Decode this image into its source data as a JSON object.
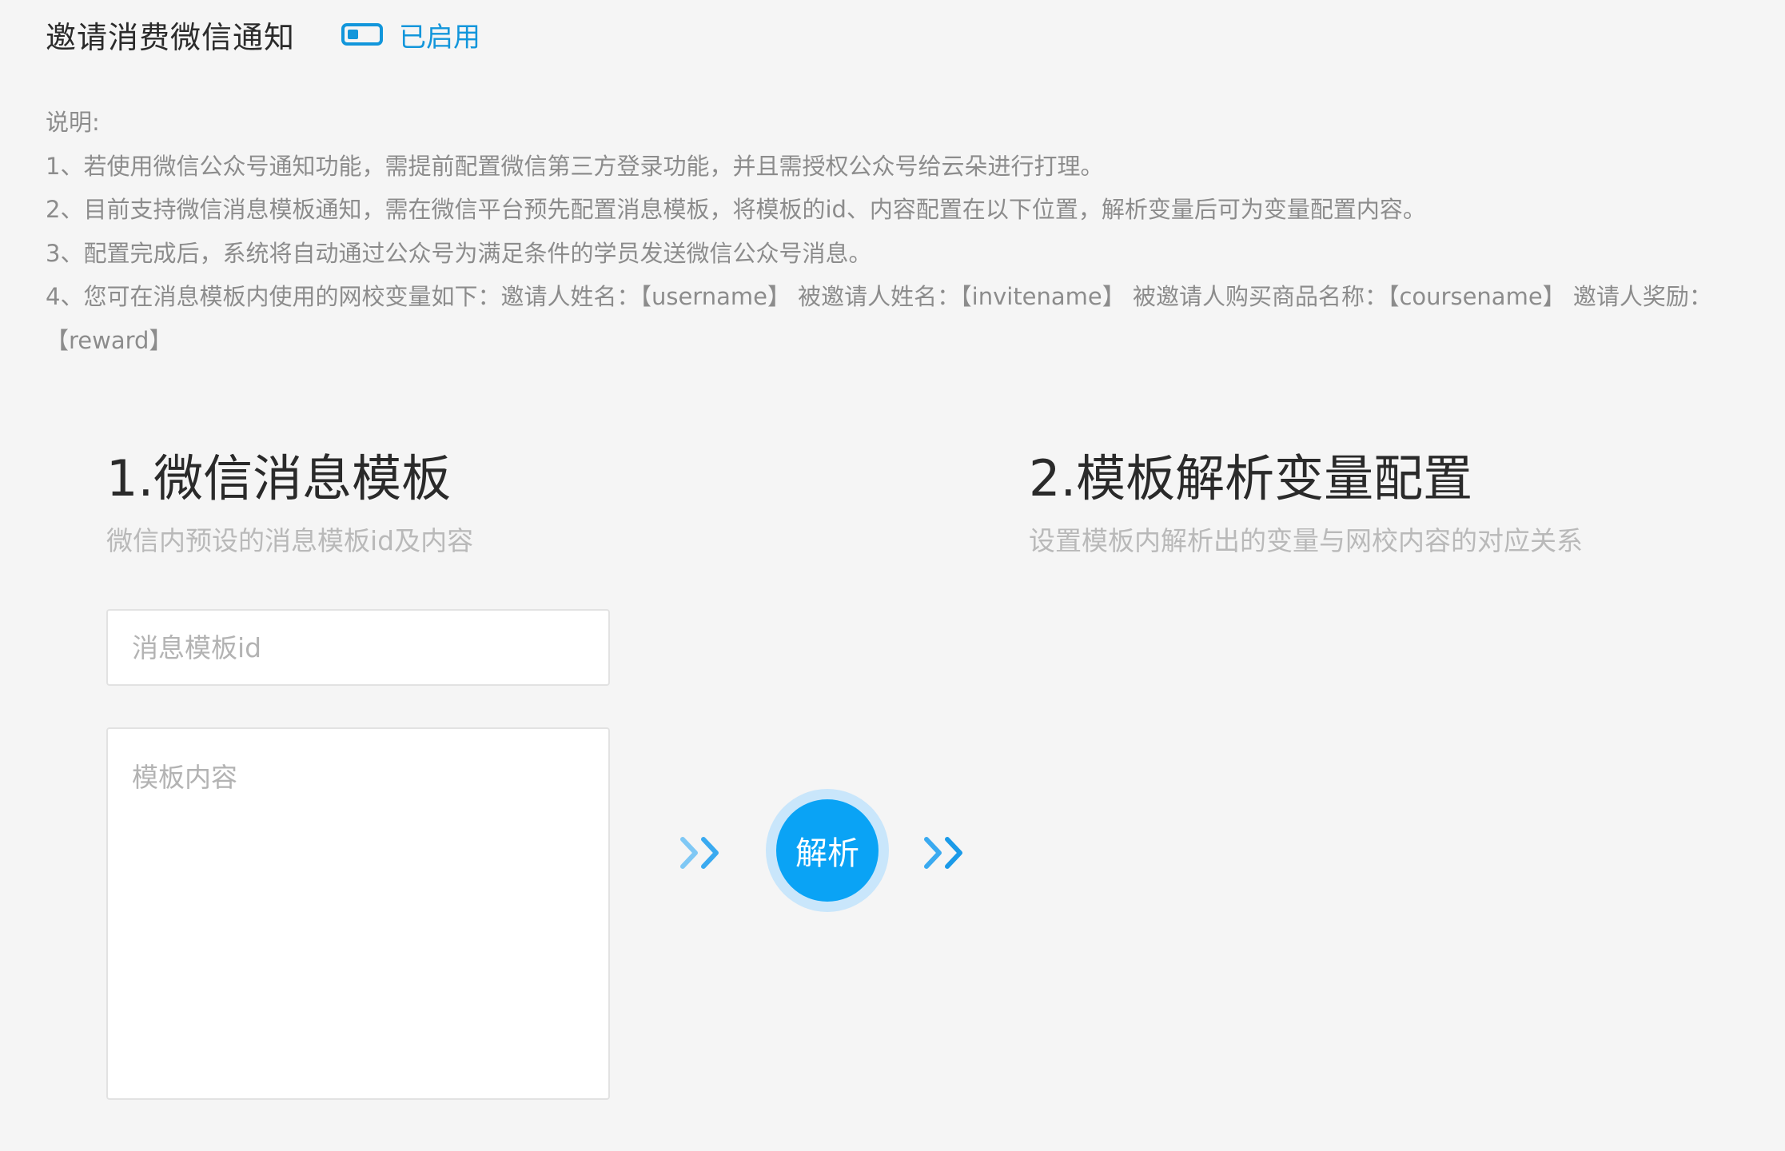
{
  "header": {
    "title": "邀请消费微信通知",
    "toggle_label": "已启用",
    "toggle_on": true,
    "accent_color": "#1296db"
  },
  "notes": {
    "heading": "说明:",
    "items": [
      "1、若使用微信公众号通知功能，需提前配置微信第三方登录功能，并且需授权公众号给云朵进行打理。",
      "2、目前支持微信消息模板通知，需在微信平台预先配置消息模板，将模板的id、内容配置在以下位置，解析变量后可为变量配置内容。",
      "3、配置完成后，系统将自动通过公众号为满足条件的学员发送微信公众号消息。",
      "4、您可在消息模板内使用的网校变量如下：邀请人姓名：【username】 被邀请人姓名：【invitename】 被邀请人购买商品名称：【coursename】 邀请人奖励：【reward】"
    ]
  },
  "section1": {
    "title": "1.微信消息模板",
    "subtitle": "微信内预设的消息模板id及内容",
    "template_id_placeholder": "消息模板id",
    "template_id_value": "",
    "template_content_placeholder": "模板内容",
    "template_content_value": ""
  },
  "parse": {
    "button_label": "解析",
    "button_color": "#0aa3f5"
  },
  "section2": {
    "title": "2.模板解析变量配置",
    "subtitle": "设置模板内解析出的变量与网校内容的对应关系"
  }
}
